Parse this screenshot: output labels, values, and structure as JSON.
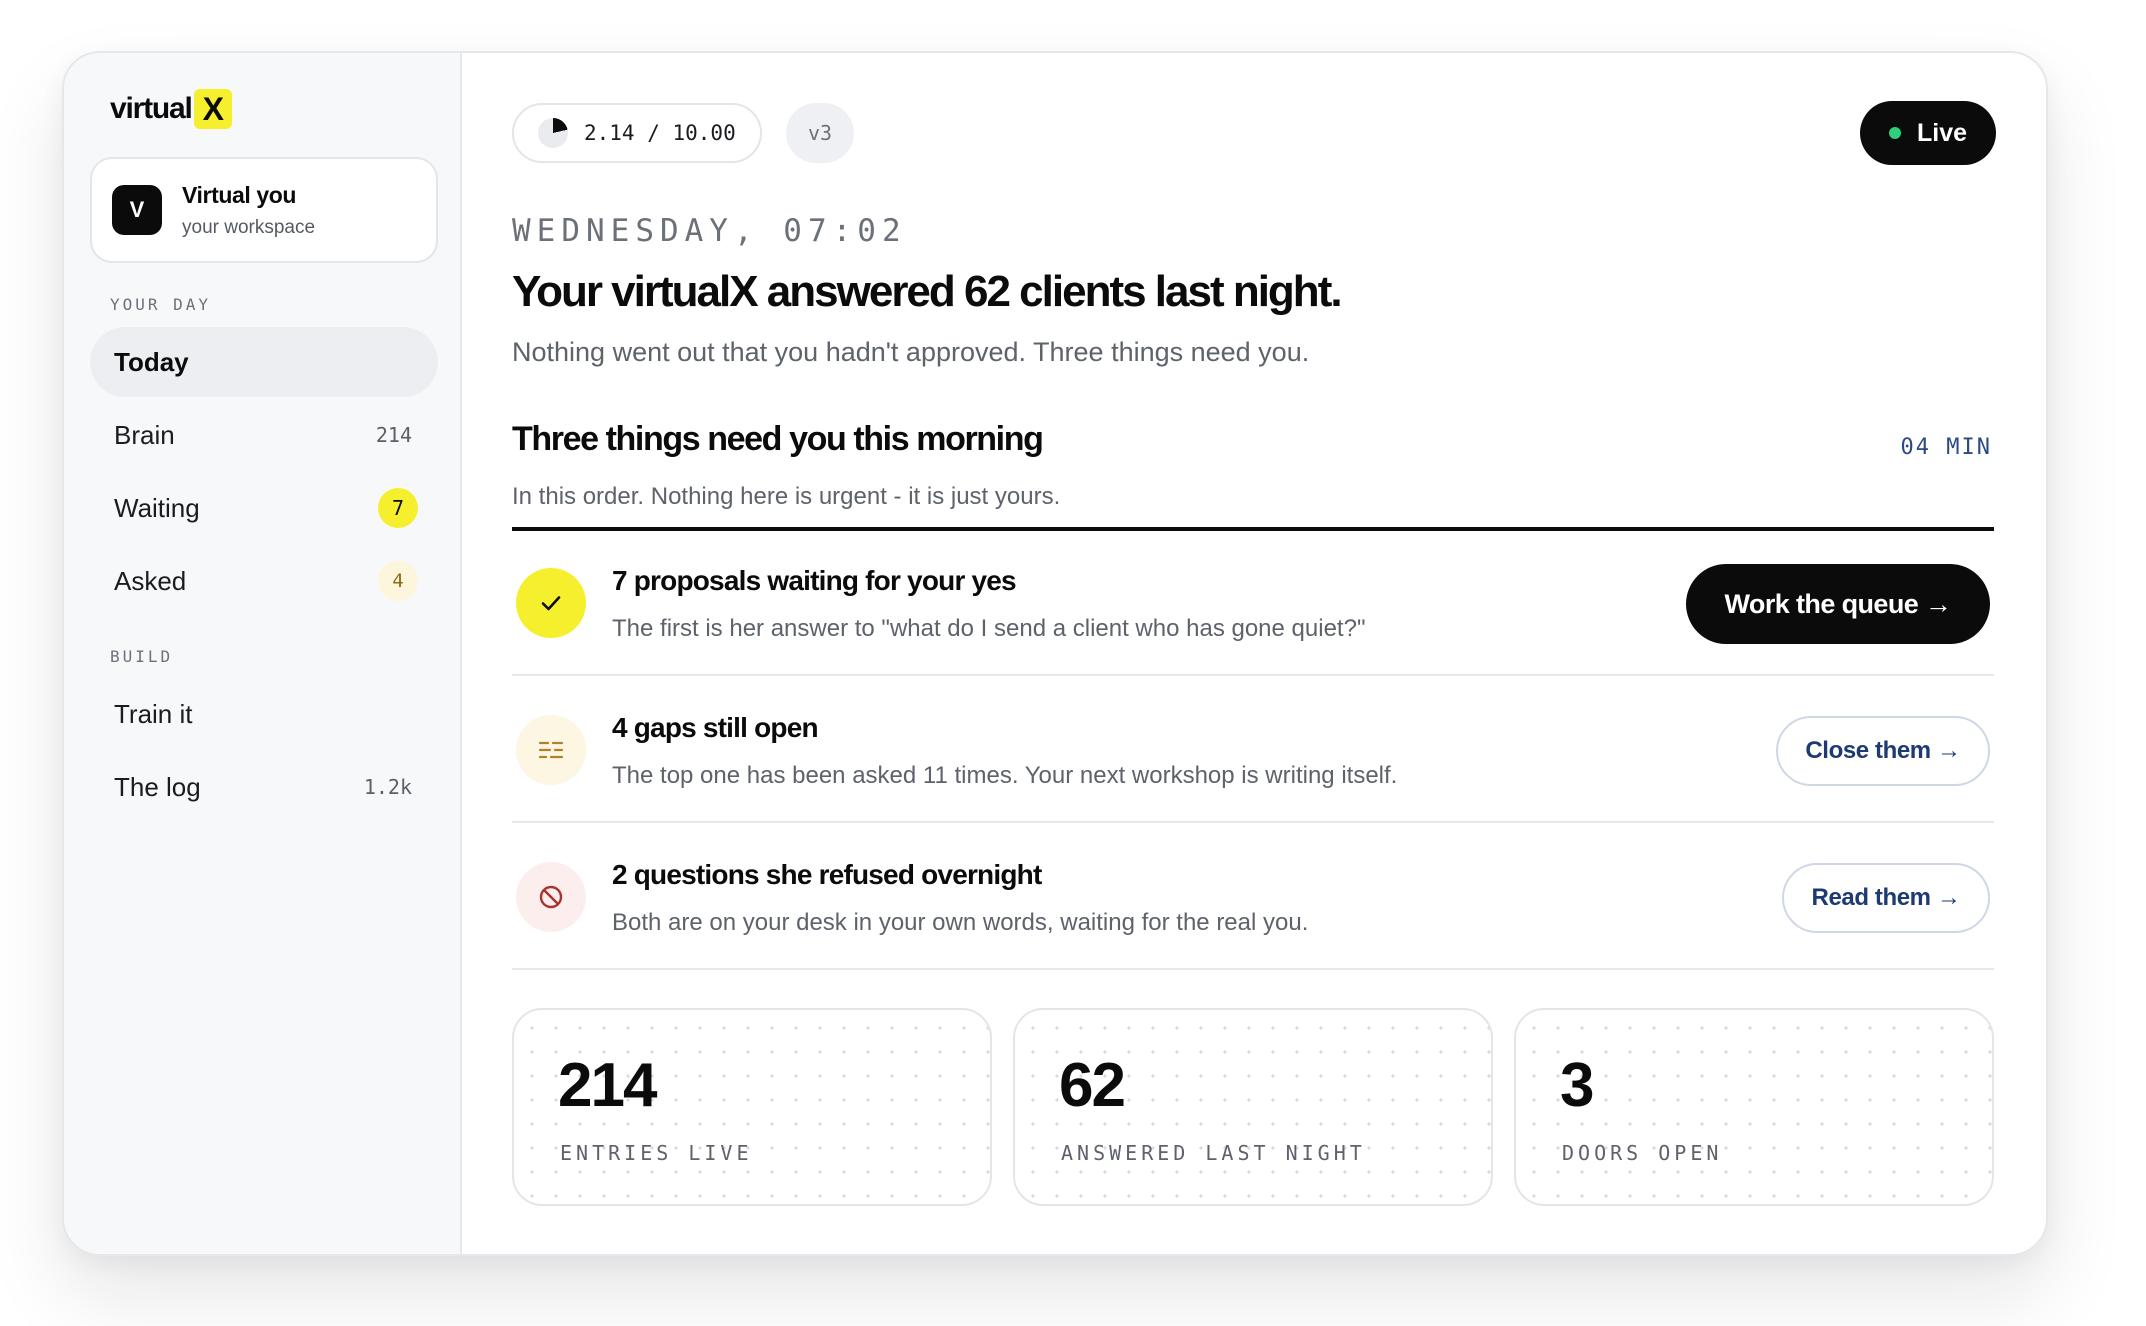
{
  "brand": {
    "name": "virtual",
    "mark": "X"
  },
  "workspace": {
    "avatar_letter": "V",
    "name": "Virtual you",
    "subtitle": "your workspace"
  },
  "sidebar": {
    "sections": [
      {
        "label": "YOUR DAY",
        "items": [
          {
            "label": "Today",
            "count": "",
            "active": true
          },
          {
            "label": "Brain",
            "count": "214"
          },
          {
            "label": "Waiting",
            "count": "7",
            "badge": "yellow"
          },
          {
            "label": "Asked",
            "count": "4",
            "badge": "soft"
          }
        ]
      },
      {
        "label": "BUILD",
        "items": [
          {
            "label": "Train it",
            "count": ""
          },
          {
            "label": "The log",
            "count": "1.2k"
          }
        ]
      }
    ]
  },
  "header": {
    "usage_text": "2.14 / 10.00",
    "usage_fraction": 0.214,
    "version": "v3",
    "status_label": "Live",
    "status_color": "#2fd07a"
  },
  "hero": {
    "dateline": "WEDNESDAY, 07:02",
    "headline": "Your virtualX answered 62 clients last night.",
    "subhead": "Nothing went out that you hadn't approved. Three things need you."
  },
  "section": {
    "title": "Three things need you this morning",
    "time": "04 MIN",
    "subtitle": "In this order. Nothing here is urgent - it is just yours."
  },
  "tasks": [
    {
      "icon": "check-icon",
      "title": "7 proposals waiting for your yes",
      "description": "The first is her answer to \"what do I send a client who has gone quiet?\"",
      "action": "Work the queue →"
    },
    {
      "icon": "gaps-icon",
      "title": "4 gaps still open",
      "description": "The top one has been asked 11 times. Your next workshop is writing itself.",
      "action": "Close them →"
    },
    {
      "icon": "blocked-icon",
      "title": "2 questions she refused overnight",
      "description": "Both are on your desk in your own words, waiting for the real you.",
      "action": "Read them →"
    }
  ],
  "stats": [
    {
      "value": "214",
      "label": "ENTRIES LIVE"
    },
    {
      "value": "62",
      "label": "ANSWERED LAST NIGHT"
    },
    {
      "value": "3",
      "label": "DOORS OPEN"
    }
  ],
  "colors": {
    "accent_yellow": "#f5ef2d",
    "ink": "#0b0b0c",
    "link_blue": "#1d3a73"
  }
}
